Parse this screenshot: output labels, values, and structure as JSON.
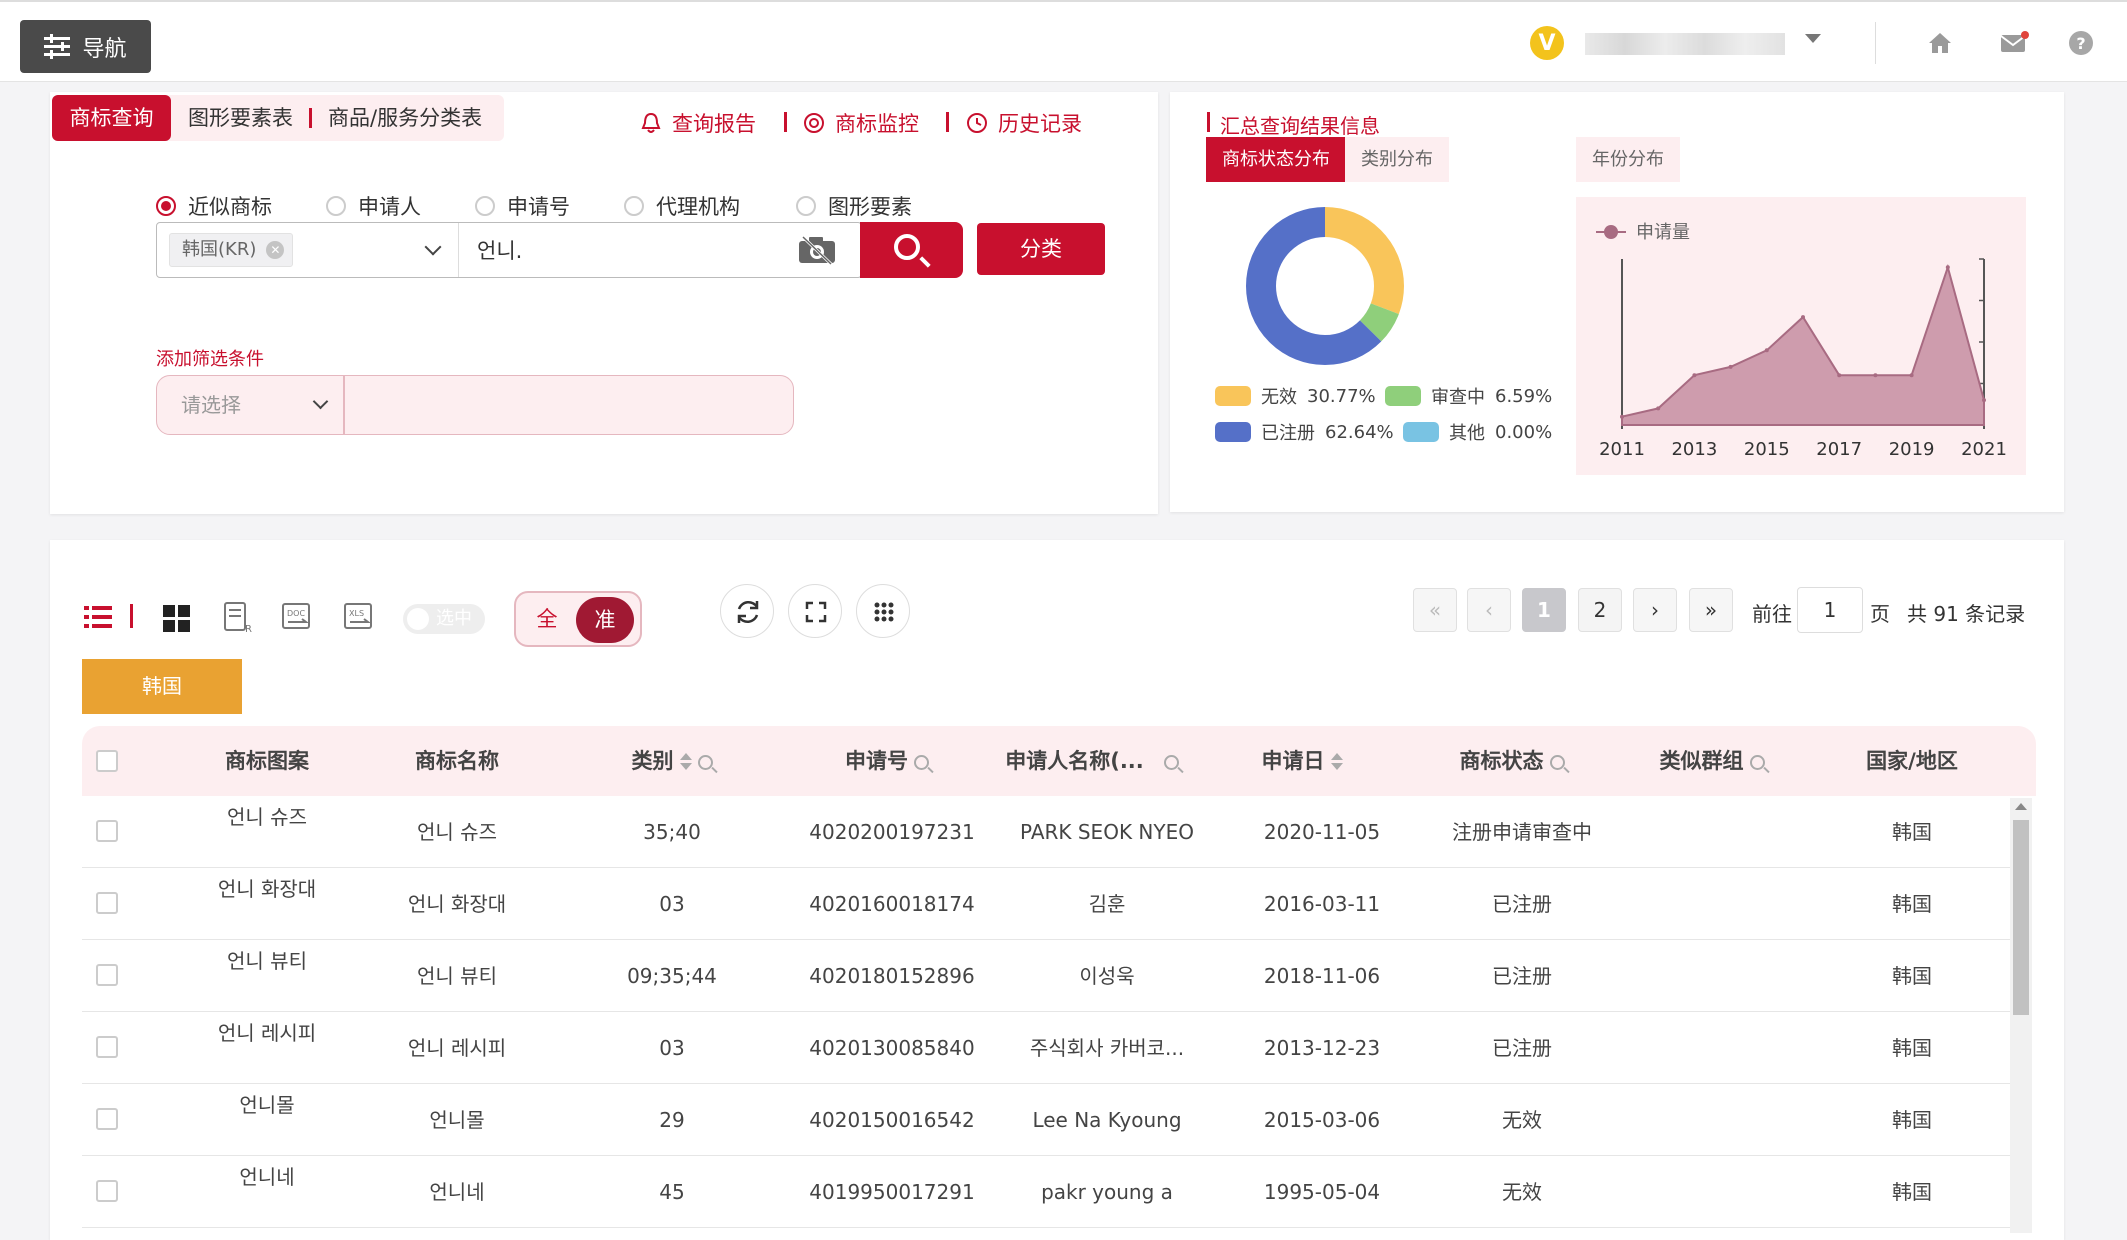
{
  "topbar": {
    "nav_label": "导航",
    "vip_badge": "V",
    "icons": [
      "home-icon",
      "mail-icon",
      "help-icon"
    ]
  },
  "search": {
    "tabs": [
      "商标查询",
      "图形要素表",
      "商品/服务分类表"
    ],
    "links": [
      "查询报告",
      "商标监控",
      "历史记录"
    ],
    "radios": [
      "近似商标",
      "申请人",
      "申请号",
      "代理机构",
      "图形要素"
    ],
    "selected_radio": "近似商标",
    "country_tag": "韩国(KR)",
    "query_value": "언니.",
    "classify_label": "分类",
    "filter_label": "添加筛选条件",
    "filter_placeholder": "请选择"
  },
  "summary": {
    "title": "汇总查询结果信息",
    "tabs": [
      "商标状态分布",
      "类别分布",
      "年份分布"
    ],
    "legend": [
      {
        "label": "无效",
        "value": "30.77%",
        "color": "#f9c55a"
      },
      {
        "label": "审查中",
        "value": "6.59%",
        "color": "#8fcf7b"
      },
      {
        "label": "已注册",
        "value": "62.64%",
        "color": "#5570c8"
      },
      {
        "label": "其他",
        "value": "0.00%",
        "color": "#79c3e3"
      }
    ]
  },
  "chart_data": [
    {
      "type": "pie",
      "categories": [
        "无效",
        "审查中",
        "已注册",
        "其他"
      ],
      "values": [
        30.77,
        6.59,
        62.64,
        0.0
      ],
      "colors": [
        "#f9c55a",
        "#8fcf7b",
        "#5570c8",
        "#79c3e3"
      ]
    },
    {
      "type": "area",
      "x_ticks": [
        "2011",
        "2013",
        "2015",
        "2017",
        "2019",
        "2021"
      ],
      "x": [
        2011,
        2012,
        2013,
        2014,
        2015,
        2016,
        2017,
        2018,
        2019,
        2020,
        2021
      ],
      "series": [
        {
          "name": "申请量",
          "values": [
            1,
            2,
            6,
            7,
            9,
            13,
            6,
            6,
            6,
            19,
            3
          ]
        }
      ],
      "ylim": [
        0,
        20
      ],
      "color": "#c68da1",
      "legend": "top-left"
    }
  ],
  "toolbar": {
    "select_toggle": "选中",
    "mode_all": "全",
    "mode_exact": "准"
  },
  "pagination": {
    "pages": [
      "1",
      "2"
    ],
    "current": "1",
    "goto_label": "前往",
    "goto_value": "1",
    "page_label": "页",
    "total_label": "共 91 条记录"
  },
  "country_chip": "韩国",
  "table": {
    "columns": [
      "商标图案",
      "商标名称",
      "类别",
      "申请号",
      "申请人名称(...",
      "申请日",
      "商标状态",
      "类似群组",
      "国家/地区"
    ],
    "rows": [
      {
        "image_text": "언니 슈즈",
        "name": "언니 슈즈",
        "class": "35;40",
        "app_no": "4020200197231",
        "applicant": "PARK SEOK NYEO",
        "date": "2020-11-05",
        "status": "注册申请审查中",
        "group": "",
        "country": "韩国"
      },
      {
        "image_text": "언니 화장대",
        "name": "언니 화장대",
        "class": "03",
        "app_no": "4020160018174",
        "applicant": "김훈",
        "date": "2016-03-11",
        "status": "已注册",
        "group": "",
        "country": "韩国"
      },
      {
        "image_text": "언니 뷰티",
        "name": "언니 뷰티",
        "class": "09;35;44",
        "app_no": "4020180152896",
        "applicant": "이성욱",
        "date": "2018-11-06",
        "status": "已注册",
        "group": "",
        "country": "韩国"
      },
      {
        "image_text": "언니 레시피",
        "name": "언니 레시피",
        "class": "03",
        "app_no": "4020130085840",
        "applicant": "주식회사 카버코...",
        "date": "2013-12-23",
        "status": "已注册",
        "group": "",
        "country": "韩国"
      },
      {
        "image_text": "언니몰",
        "name": "언니몰",
        "class": "29",
        "app_no": "4020150016542",
        "applicant": "Lee Na Kyoung",
        "date": "2015-03-06",
        "status": "无效",
        "group": "",
        "country": "韩国"
      },
      {
        "image_text": "언니네",
        "name": "언니네",
        "class": "45",
        "app_no": "4019950017291",
        "applicant": "pakr young a",
        "date": "1995-05-04",
        "status": "无效",
        "group": "",
        "country": "韩国"
      }
    ]
  }
}
